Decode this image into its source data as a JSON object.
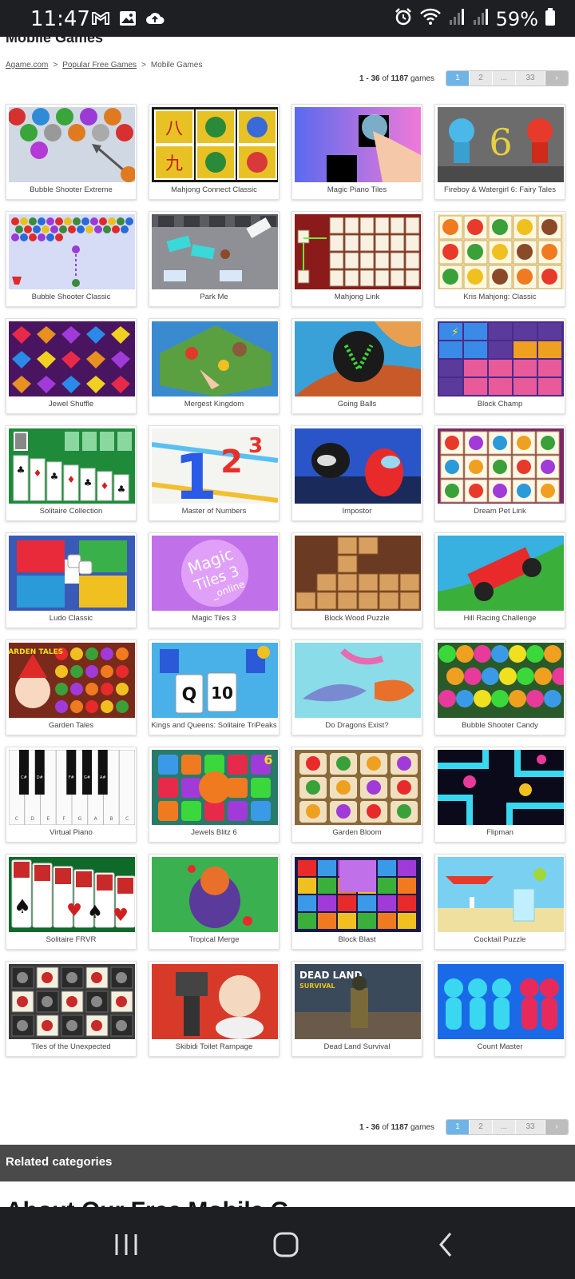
{
  "status_bar": {
    "time": "11:47",
    "battery": "59%",
    "icons_left": [
      "gmail-icon",
      "gallery-icon",
      "cloud-upload-icon"
    ],
    "icons_right": [
      "alarm-icon",
      "wifi-icon",
      "signal-icon",
      "signal-icon",
      "battery-icon"
    ]
  },
  "page": {
    "title": "Mobile Games",
    "breadcrumb": {
      "home": "Agame.com",
      "sep": ">",
      "popular": "Popular Free Games",
      "current": "Mobile Games"
    }
  },
  "pagination": {
    "range": "1 - 36",
    "of": "of",
    "total": "1187",
    "unit": "games",
    "pages": [
      "1",
      "2",
      "...",
      "33"
    ],
    "next": "›"
  },
  "games": [
    "Bubble Shooter Extreme",
    "Mahjong Connect Classic",
    "Magic Piano Tiles",
    "Fireboy & Watergirl 6: Fairy Tales",
    "Bubble Shooter Classic",
    "Park Me",
    "Mahjong Link",
    "Kris Mahjong: Classic",
    "Jewel Shuffle",
    "Mergest Kingdom",
    "Going Balls",
    "Block Champ",
    "Solitaire Collection",
    "Master of Numbers",
    "Impostor",
    "Dream Pet Link",
    "Ludo Classic",
    "Magic Tiles 3",
    "Block Wood Puzzle",
    "Hill Racing Challenge",
    "Garden Tales",
    "Kings and Queens: Solitaire TriPeaks",
    "Do Dragons Exist?",
    "Bubble Shooter Candy",
    "Virtual Piano",
    "Jewels Blitz 6",
    "Garden Bloom",
    "Flipman",
    "Solitaire FRVR",
    "Tropical Merge",
    "Block Blast",
    "Cocktail Puzzle",
    "Tiles of the Unexpected",
    "Skibidi Toilet Rampage",
    "Dead Land Survival",
    "Count Master"
  ],
  "thumb_text": {
    "master_numbers": "1",
    "master_numbers_2": "2",
    "master_numbers_3": "3",
    "magic_tiles": "Magic",
    "magic_tiles_2": "Tiles 3",
    "magic_tiles_3": "_online",
    "fireboy": "6",
    "jewels_blitz": "6",
    "kings_q": "Q",
    "kings_10": "10",
    "garden_tales": "GARDEN TALES",
    "dead_land": "DEAD LAND",
    "dead_land_2": "SURVIVAL",
    "piano_keys": [
      "C",
      "D",
      "E",
      "F",
      "G",
      "A",
      "B",
      "C"
    ],
    "piano_sharps": [
      "C#",
      "D#",
      "F#",
      "G#",
      "A#"
    ]
  },
  "thumb_colors": [
    "#cfd8e3",
    "#e8c224",
    "#7f8cf0",
    "#6c6c6c",
    "#d6dcf5",
    "#8e9096",
    "#8b1a1a",
    "#f4e7b8",
    "#4a1560",
    "#5aa040",
    "#3aa0d8",
    "#4a2a8a",
    "#1f8a3a",
    "#f4f4f0",
    "#2a55c8",
    "#7a2a6a",
    "#3a5ab8",
    "#c070e8",
    "#6a3a22",
    "#38b0e0",
    "#7a2a1a",
    "#4ab0e8",
    "#8adce8",
    "#2a5a2a",
    "#f0f0f0",
    "#2a7a6a",
    "#8a6a3a",
    "#0a0a1a",
    "#0f6a2a",
    "#3ab050",
    "#1a1a4a",
    "#7ad0f0",
    "#3a3a3a",
    "#d83a2a",
    "#3a4a5a",
    "#1a6ae8"
  ],
  "related": "Related categories",
  "about": "About Our Free Mobile G"
}
